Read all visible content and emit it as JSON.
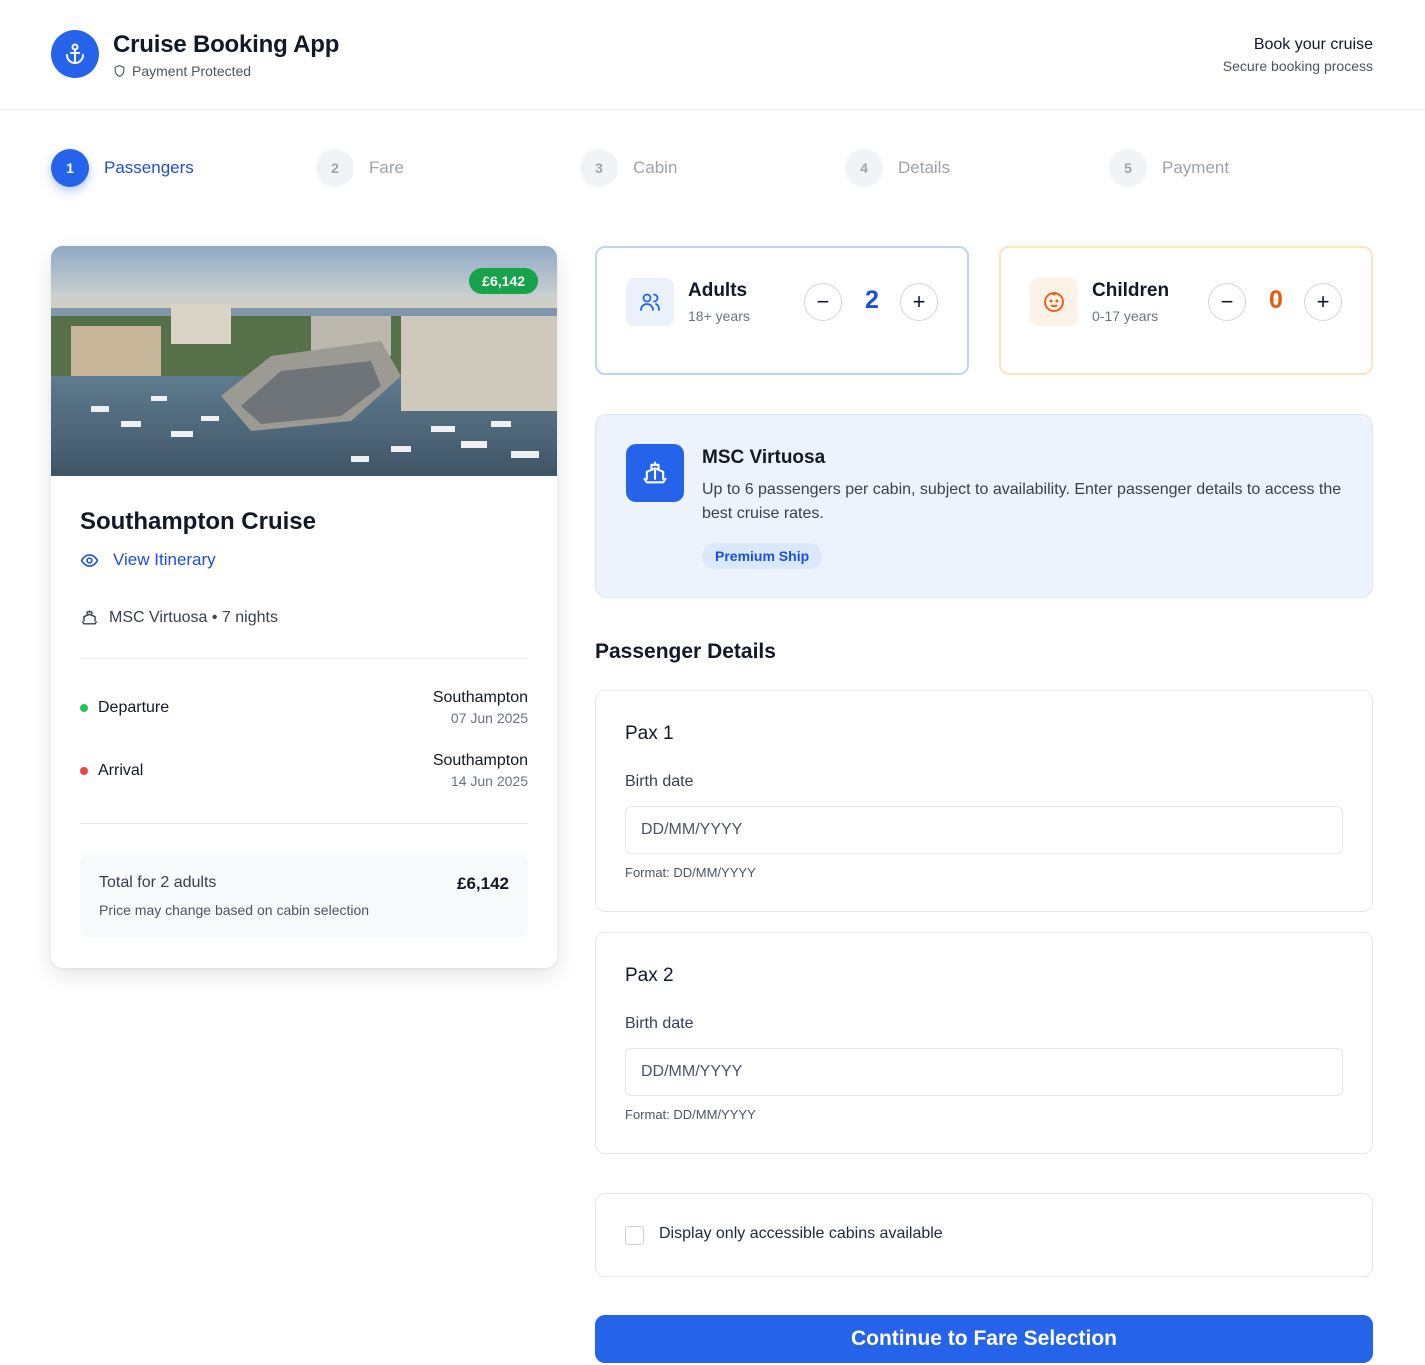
{
  "header": {
    "app_title": "Cruise Booking App",
    "protected_label": "Payment Protected",
    "right_title": "Book your cruise",
    "right_subtitle": "Secure booking process"
  },
  "steps": [
    {
      "number": "1",
      "label": "Passengers",
      "active": true
    },
    {
      "number": "2",
      "label": "Fare",
      "active": false
    },
    {
      "number": "3",
      "label": "Cabin",
      "active": false
    },
    {
      "number": "4",
      "label": "Details",
      "active": false
    },
    {
      "number": "5",
      "label": "Payment",
      "active": false
    }
  ],
  "cruise": {
    "price_badge": "£6,142",
    "name": "Southampton Cruise",
    "itinerary_link": "View Itinerary",
    "ship_line": "MSC Virtuosa • 7 nights",
    "departure": {
      "label": "Departure",
      "city": "Southampton",
      "date": "07 Jun 2025",
      "dot_color": "#22c55e"
    },
    "arrival": {
      "label": "Arrival",
      "city": "Southampton",
      "date": "14 Jun 2025",
      "dot_color": "#ef4444"
    },
    "total_label": "Total for 2 adults",
    "total_note": "Price may change based on cabin selection",
    "total_price": "£6,142"
  },
  "adults": {
    "title": "Adults",
    "subtitle": "18+ years",
    "value": "2",
    "minus": "−",
    "plus": "+",
    "value_color": "#1d4ed8"
  },
  "children": {
    "title": "Children",
    "subtitle": "0-17 years",
    "value": "0",
    "minus": "−",
    "plus": "+",
    "value_color": "#ea580c"
  },
  "ship_info": {
    "title": "MSC Virtuosa",
    "description": "Up to 6 passengers per cabin, subject to availability. Enter passenger details to access the best cruise rates.",
    "badge": "Premium Ship"
  },
  "passenger_section_title": "Passenger Details",
  "passengers": [
    {
      "title": "Pax 1",
      "birth_label": "Birth date",
      "placeholder": "DD/MM/YYYY",
      "format_hint": "Format: DD/MM/YYYY"
    },
    {
      "title": "Pax 2",
      "birth_label": "Birth date",
      "placeholder": "DD/MM/YYYY",
      "format_hint": "Format: DD/MM/YYYY"
    }
  ],
  "accessible_label": "Display only accessible cabins available",
  "continue_label": "Continue to Fare Selection",
  "colors": {
    "accent": "#2563eb",
    "success": "#16a34a"
  }
}
